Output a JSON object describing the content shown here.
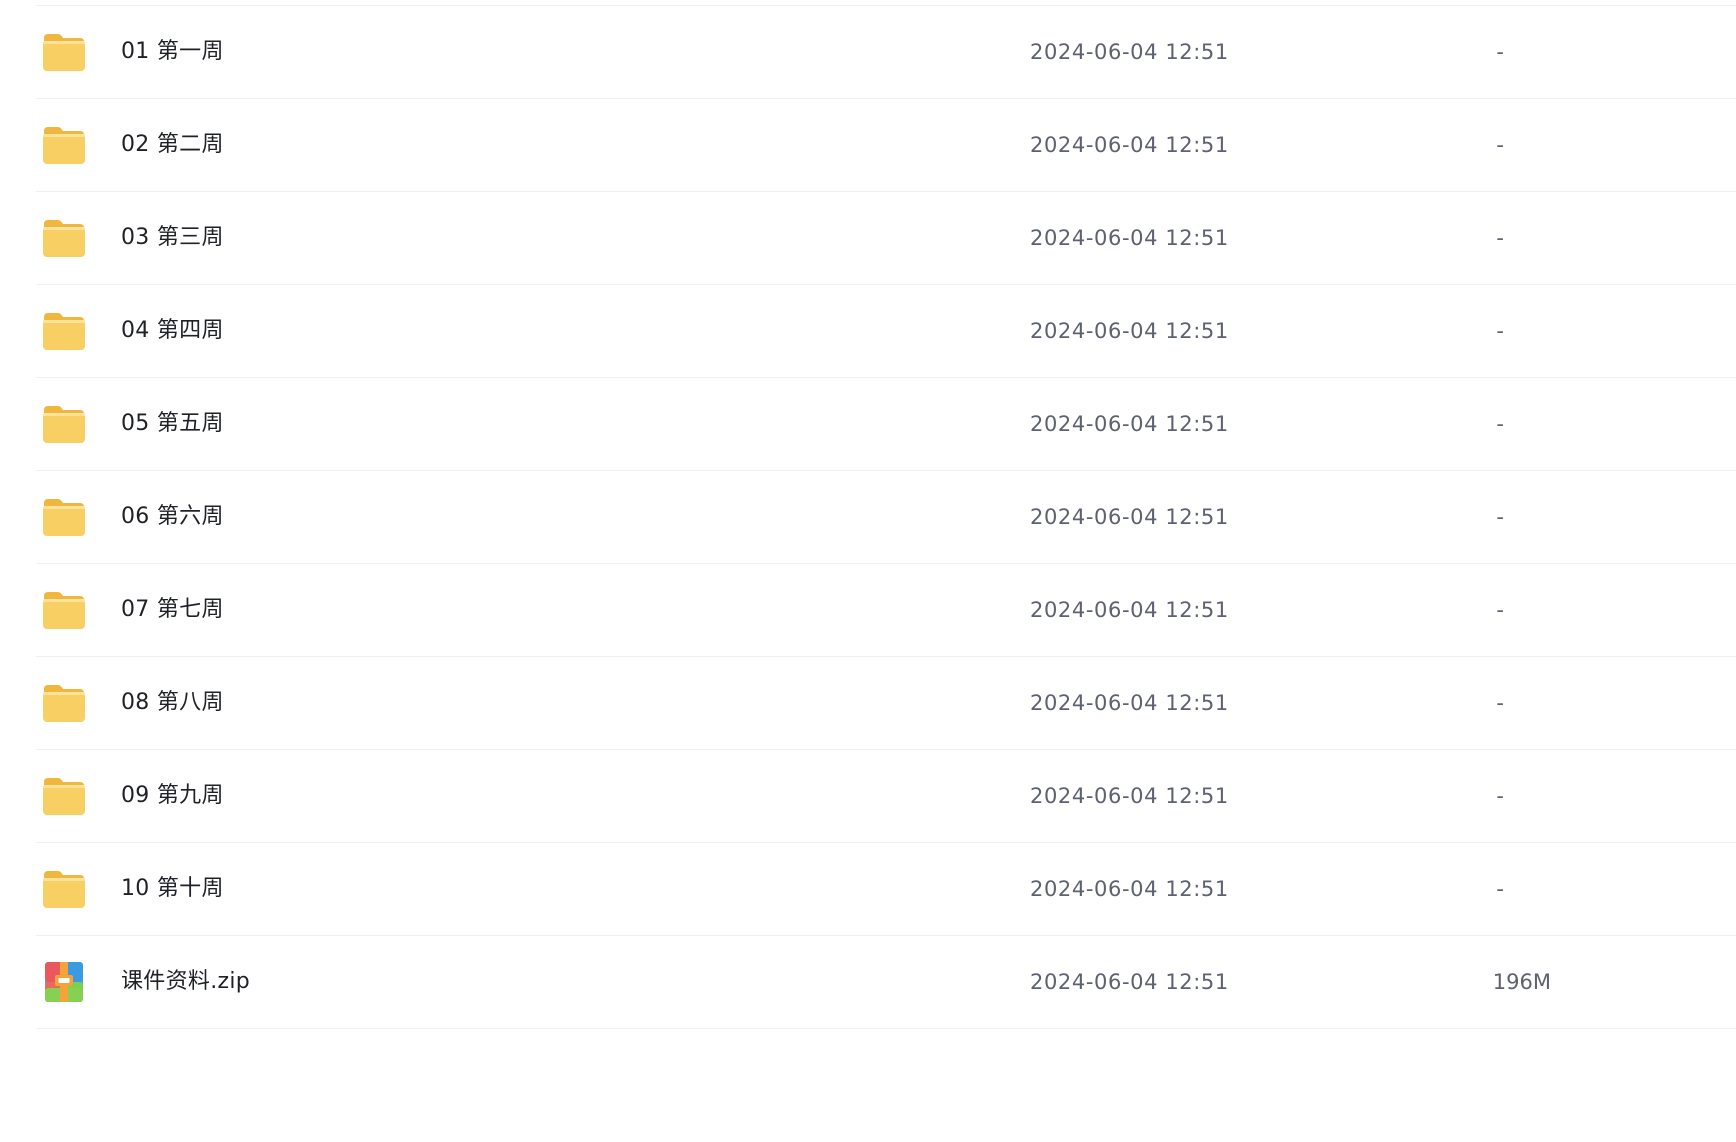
{
  "file_list": {
    "rows": [
      {
        "name": "01 第一周",
        "modified": "2024-06-04 12:51",
        "size": "-",
        "type": "folder",
        "icon": "folder-icon"
      },
      {
        "name": "02 第二周",
        "modified": "2024-06-04 12:51",
        "size": "-",
        "type": "folder",
        "icon": "folder-icon"
      },
      {
        "name": "03 第三周",
        "modified": "2024-06-04 12:51",
        "size": "-",
        "type": "folder",
        "icon": "folder-icon"
      },
      {
        "name": "04 第四周",
        "modified": "2024-06-04 12:51",
        "size": "-",
        "type": "folder",
        "icon": "folder-icon"
      },
      {
        "name": "05 第五周",
        "modified": "2024-06-04 12:51",
        "size": "-",
        "type": "folder",
        "icon": "folder-icon"
      },
      {
        "name": "06 第六周",
        "modified": "2024-06-04 12:51",
        "size": "-",
        "type": "folder",
        "icon": "folder-icon"
      },
      {
        "name": "07 第七周",
        "modified": "2024-06-04 12:51",
        "size": "-",
        "type": "folder",
        "icon": "folder-icon"
      },
      {
        "name": "08 第八周",
        "modified": "2024-06-04 12:51",
        "size": "-",
        "type": "folder",
        "icon": "folder-icon"
      },
      {
        "name": "09 第九周",
        "modified": "2024-06-04 12:51",
        "size": "-",
        "type": "folder",
        "icon": "folder-icon"
      },
      {
        "name": "10 第十周",
        "modified": "2024-06-04 12:51",
        "size": "-",
        "type": "folder",
        "icon": "folder-icon"
      },
      {
        "name": "课件资料.zip",
        "modified": "2024-06-04 12:51",
        "size": "196M",
        "type": "zip",
        "icon": "zip-archive-icon"
      }
    ]
  },
  "colors": {
    "folder": "#f5c75a",
    "folder_tab": "#f0b73e",
    "text_primary": "#1f2126",
    "text_secondary": "#5d6170",
    "divider": "#eef0f3"
  }
}
